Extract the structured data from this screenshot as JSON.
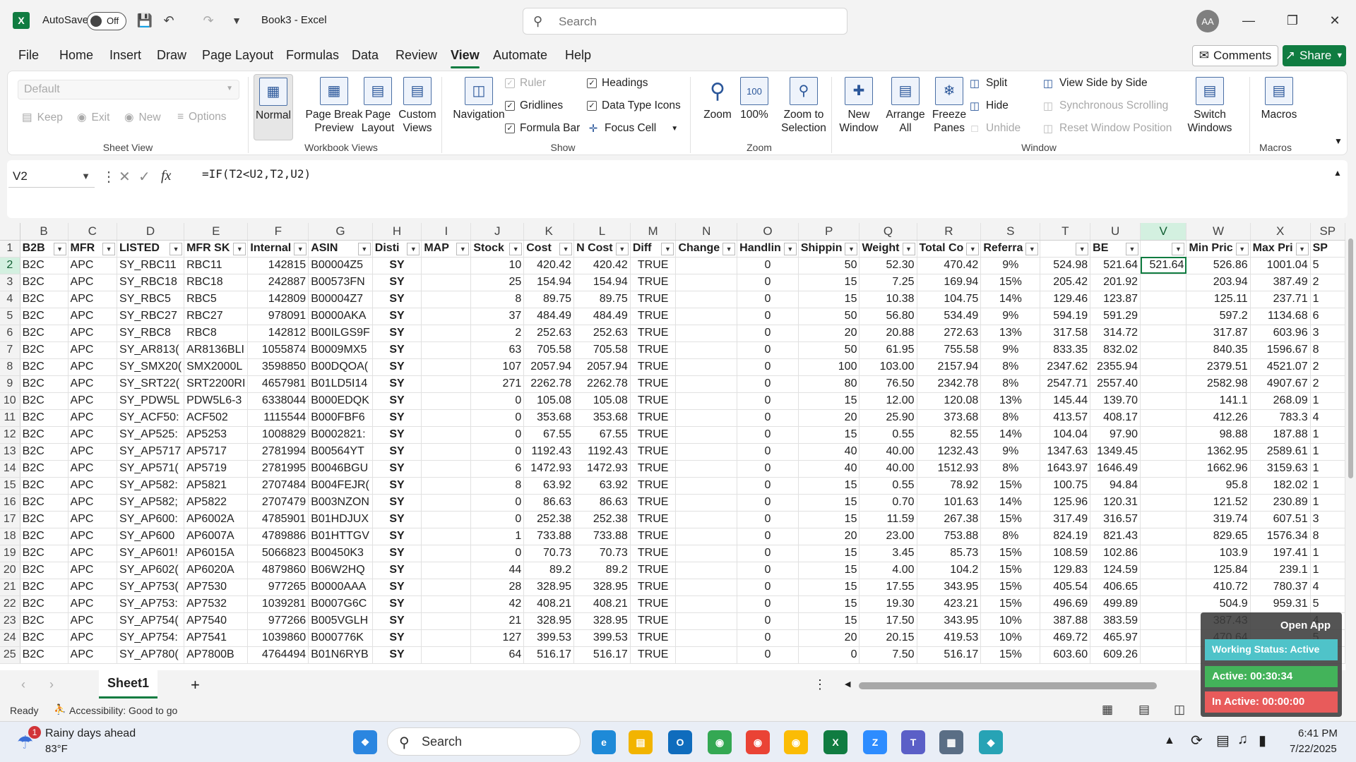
{
  "app": {
    "title": "Book3 - Excel",
    "autosave_label": "AutoSave",
    "autosave_state": "Off",
    "search_placeholder": "Search",
    "user_initials": "AA"
  },
  "menu": [
    "File",
    "Home",
    "Insert",
    "Draw",
    "Page Layout",
    "Formulas",
    "Data",
    "Review",
    "View",
    "Automate",
    "Help"
  ],
  "menu_active": "View",
  "actions": {
    "comments": "Comments",
    "share": "Share"
  },
  "ribbon": {
    "sheet_view": {
      "label": "Sheet View",
      "dropdown": "Default",
      "keep": "Keep",
      "exit": "Exit",
      "new": "New",
      "options": "Options"
    },
    "workbook_views": {
      "label": "Workbook Views",
      "normal": "Normal",
      "page_break_1": "Page Break",
      "page_break_2": "Preview",
      "page_layout_1": "Page",
      "page_layout_2": "Layout",
      "custom_1": "Custom",
      "custom_2": "Views"
    },
    "navigation": "Navigation",
    "show": {
      "label": "Show",
      "ruler": "Ruler",
      "gridlines": "Gridlines",
      "formula_bar": "Formula Bar",
      "headings": "Headings",
      "data_type_icons": "Data Type Icons",
      "focus_cell": "Focus Cell"
    },
    "zoom": {
      "label": "Zoom",
      "zoom": "Zoom",
      "hundred": "100%",
      "zts_1": "Zoom to",
      "zts_2": "Selection"
    },
    "window": {
      "label": "Window",
      "new_1": "New",
      "new_2": "Window",
      "arrange_1": "Arrange",
      "arrange_2": "All",
      "freeze_1": "Freeze",
      "freeze_2": "Panes",
      "split": "Split",
      "hide": "Hide",
      "unhide": "Unhide",
      "side_by_side": "View Side by Side",
      "sync_scroll": "Synchronous Scrolling",
      "reset_pos": "Reset Window Position",
      "switch_1": "Switch",
      "switch_2": "Windows"
    },
    "macros": {
      "label": "Macros",
      "macros": "Macros"
    }
  },
  "formula_bar": {
    "name_box": "V2",
    "formula": "=IF(T2<U2,T2,U2)"
  },
  "grid": {
    "columns": [
      "B",
      "C",
      "D",
      "E",
      "F",
      "G",
      "H",
      "I",
      "J",
      "K",
      "L",
      "M",
      "N",
      "O",
      "P",
      "Q",
      "R",
      "S",
      "T",
      "U",
      "V",
      "W",
      "X",
      "SP"
    ],
    "headers": [
      "B2B",
      "MFR",
      "LISTED",
      "MFR SK",
      "Internal",
      "ASIN",
      "Disti",
      "MAP",
      "Stock",
      "Cost",
      "N Cost",
      "Diff",
      "Change",
      "Handlin",
      "Shippin",
      "Weight",
      "Total Co",
      "Referra",
      "",
      "BE",
      "",
      "Min Pric",
      "Max Pri",
      "SP"
    ],
    "rows": [
      [
        "2",
        "B2C",
        "APC",
        "SY_RBC11",
        "RBC11",
        "142815",
        "B00004Z5",
        "SY",
        "",
        "10",
        "420.42",
        "420.42",
        "TRUE",
        "",
        "0",
        "50",
        "52.30",
        "470.42",
        "9%",
        "524.98",
        "521.64",
        "521.64",
        "526.86",
        "1001.04",
        "5"
      ],
      [
        "3",
        "B2C",
        "APC",
        "SY_RBC18",
        "RBC18",
        "242887",
        "B00573FN",
        "SY",
        "",
        "25",
        "154.94",
        "154.94",
        "TRUE",
        "",
        "0",
        "15",
        "7.25",
        "169.94",
        "15%",
        "205.42",
        "201.92",
        "",
        "203.94",
        "387.49",
        "2"
      ],
      [
        "4",
        "B2C",
        "APC",
        "SY_RBC5",
        "RBC5",
        "142809",
        "B00004Z7",
        "SY",
        "",
        "8",
        "89.75",
        "89.75",
        "TRUE",
        "",
        "0",
        "15",
        "10.38",
        "104.75",
        "14%",
        "129.46",
        "123.87",
        "",
        "125.11",
        "237.71",
        "1"
      ],
      [
        "5",
        "B2C",
        "APC",
        "SY_RBC27",
        "RBC27",
        "978091",
        "B0000AKA",
        "SY",
        "",
        "37",
        "484.49",
        "484.49",
        "TRUE",
        "",
        "0",
        "50",
        "56.80",
        "534.49",
        "9%",
        "594.19",
        "591.29",
        "",
        "597.2",
        "1134.68",
        "6"
      ],
      [
        "6",
        "B2C",
        "APC",
        "SY_RBC8",
        "RBC8",
        "142812",
        "B00ILGS9F",
        "SY",
        "",
        "2",
        "252.63",
        "252.63",
        "TRUE",
        "",
        "0",
        "20",
        "20.88",
        "272.63",
        "13%",
        "317.58",
        "314.72",
        "",
        "317.87",
        "603.96",
        "3"
      ],
      [
        "7",
        "B2C",
        "APC",
        "SY_AR813(",
        "AR8136BLI",
        "1055874",
        "B0009MX5",
        "SY",
        "",
        "63",
        "705.58",
        "705.58",
        "TRUE",
        "",
        "0",
        "50",
        "61.95",
        "755.58",
        "9%",
        "833.35",
        "832.02",
        "",
        "840.35",
        "1596.67",
        "8"
      ],
      [
        "8",
        "B2C",
        "APC",
        "SY_SMX20(",
        "SMX2000L",
        "3598850",
        "B00DQOA(",
        "SY",
        "",
        "107",
        "2057.94",
        "2057.94",
        "TRUE",
        "",
        "0",
        "100",
        "103.00",
        "2157.94",
        "8%",
        "2347.62",
        "2355.94",
        "",
        "2379.51",
        "4521.07",
        "2"
      ],
      [
        "9",
        "B2C",
        "APC",
        "SY_SRT22(",
        "SRT2200RI",
        "4657981",
        "B01LD5I14",
        "SY",
        "",
        "271",
        "2262.78",
        "2262.78",
        "TRUE",
        "",
        "0",
        "80",
        "76.50",
        "2342.78",
        "8%",
        "2547.71",
        "2557.40",
        "",
        "2582.98",
        "4907.67",
        "2"
      ],
      [
        "10",
        "B2C",
        "APC",
        "SY_PDW5L",
        "PDW5L6-3",
        "6338044",
        "B000EDQK",
        "SY",
        "",
        "0",
        "105.08",
        "105.08",
        "TRUE",
        "",
        "0",
        "15",
        "12.00",
        "120.08",
        "13%",
        "145.44",
        "139.70",
        "",
        "141.1",
        "268.09",
        "1"
      ],
      [
        "11",
        "B2C",
        "APC",
        "SY_ACF50:",
        "ACF502",
        "1115544",
        "B000FBF6",
        "SY",
        "",
        "0",
        "353.68",
        "353.68",
        "TRUE",
        "",
        "0",
        "20",
        "25.90",
        "373.68",
        "8%",
        "413.57",
        "408.17",
        "",
        "412.26",
        "783.3",
        "4"
      ],
      [
        "12",
        "B2C",
        "APC",
        "SY_AP525:",
        "AP5253",
        "1008829",
        "B0002821:",
        "SY",
        "",
        "0",
        "67.55",
        "67.55",
        "TRUE",
        "",
        "0",
        "15",
        "0.55",
        "82.55",
        "14%",
        "104.04",
        "97.90",
        "",
        "98.88",
        "187.88",
        "1"
      ],
      [
        "13",
        "B2C",
        "APC",
        "SY_AP5717",
        "AP5717",
        "2781994",
        "B00564YT",
        "SY",
        "",
        "0",
        "1192.43",
        "1192.43",
        "TRUE",
        "",
        "0",
        "40",
        "40.00",
        "1232.43",
        "9%",
        "1347.63",
        "1349.45",
        "",
        "1362.95",
        "2589.61",
        "1"
      ],
      [
        "14",
        "B2C",
        "APC",
        "SY_AP571(",
        "AP5719",
        "2781995",
        "B0046BGU",
        "SY",
        "",
        "6",
        "1472.93",
        "1472.93",
        "TRUE",
        "",
        "0",
        "40",
        "40.00",
        "1512.93",
        "8%",
        "1643.97",
        "1646.49",
        "",
        "1662.96",
        "3159.63",
        "1"
      ],
      [
        "15",
        "B2C",
        "APC",
        "SY_AP582:",
        "AP5821",
        "2707484",
        "B004FEJR(",
        "SY",
        "",
        "8",
        "63.92",
        "63.92",
        "TRUE",
        "",
        "0",
        "15",
        "0.55",
        "78.92",
        "15%",
        "100.75",
        "94.84",
        "",
        "95.8",
        "182.02",
        "1"
      ],
      [
        "16",
        "B2C",
        "APC",
        "SY_AP582;",
        "AP5822",
        "2707479",
        "B003NZON",
        "SY",
        "",
        "0",
        "86.63",
        "86.63",
        "TRUE",
        "",
        "0",
        "15",
        "0.70",
        "101.63",
        "14%",
        "125.96",
        "120.31",
        "",
        "121.52",
        "230.89",
        "1"
      ],
      [
        "17",
        "B2C",
        "APC",
        "SY_AP600:",
        "AP6002A",
        "4785901",
        "B01HDJUX",
        "SY",
        "",
        "0",
        "252.38",
        "252.38",
        "TRUE",
        "",
        "0",
        "15",
        "11.59",
        "267.38",
        "15%",
        "317.49",
        "316.57",
        "",
        "319.74",
        "607.51",
        "3"
      ],
      [
        "18",
        "B2C",
        "APC",
        "SY_AP600",
        "AP6007A",
        "4789886",
        "B01HTTGV",
        "SY",
        "",
        "1",
        "733.88",
        "733.88",
        "TRUE",
        "",
        "0",
        "20",
        "23.00",
        "753.88",
        "8%",
        "824.19",
        "821.43",
        "",
        "829.65",
        "1576.34",
        "8"
      ],
      [
        "19",
        "B2C",
        "APC",
        "SY_AP601!",
        "AP6015A",
        "5066823",
        "B00450K3",
        "SY",
        "",
        "0",
        "70.73",
        "70.73",
        "TRUE",
        "",
        "0",
        "15",
        "3.45",
        "85.73",
        "15%",
        "108.59",
        "102.86",
        "",
        "103.9",
        "197.41",
        "1"
      ],
      [
        "20",
        "B2C",
        "APC",
        "SY_AP602(",
        "AP6020A",
        "4879860",
        "B06W2HQ",
        "SY",
        "",
        "44",
        "89.2",
        "89.2",
        "TRUE",
        "",
        "0",
        "15",
        "4.00",
        "104.2",
        "15%",
        "129.83",
        "124.59",
        "",
        "125.84",
        "239.1",
        "1"
      ],
      [
        "21",
        "B2C",
        "APC",
        "SY_AP753(",
        "AP7530",
        "977265",
        "B0000AAA",
        "SY",
        "",
        "28",
        "328.95",
        "328.95",
        "TRUE",
        "",
        "0",
        "15",
        "17.55",
        "343.95",
        "15%",
        "405.54",
        "406.65",
        "",
        "410.72",
        "780.37",
        "4"
      ],
      [
        "22",
        "B2C",
        "APC",
        "SY_AP753:",
        "AP7532",
        "1039281",
        "B0007G6C",
        "SY",
        "",
        "42",
        "408.21",
        "408.21",
        "TRUE",
        "",
        "0",
        "15",
        "19.30",
        "423.21",
        "15%",
        "496.69",
        "499.89",
        "",
        "504.9",
        "959.31",
        "5"
      ],
      [
        "23",
        "B2C",
        "APC",
        "SY_AP754(",
        "AP7540",
        "977266",
        "B005VGLH",
        "SY",
        "",
        "21",
        "328.95",
        "328.95",
        "TRUE",
        "",
        "0",
        "15",
        "17.50",
        "343.95",
        "10%",
        "387.88",
        "383.59",
        "",
        "387.43",
        "",
        "4"
      ],
      [
        "24",
        "B2C",
        "APC",
        "SY_AP754:",
        "AP7541",
        "1039860",
        "B000776K",
        "SY",
        "",
        "127",
        "399.53",
        "399.53",
        "TRUE",
        "",
        "0",
        "20",
        "20.15",
        "419.53",
        "10%",
        "469.72",
        "465.97",
        "",
        "470.64",
        "",
        "5"
      ],
      [
        "25",
        "B2C",
        "APC",
        "SY_AP780(",
        "AP7800B",
        "4764494",
        "B01N6RYB",
        "SY",
        "",
        "64",
        "516.17",
        "516.17",
        "TRUE",
        "",
        "0",
        "0",
        "7.50",
        "516.17",
        "15%",
        "603.60",
        "609.26",
        "",
        "",
        "",
        "6"
      ]
    ]
  },
  "sheet_tab": "Sheet1",
  "status": {
    "ready": "Ready",
    "accessibility": "Accessibility: Good to go"
  },
  "widget": {
    "open_app": "Open App",
    "working": "Working Status: Active",
    "active": "Active: 00:30:34",
    "inactive": "In Active: 00:00:00"
  },
  "taskbar": {
    "weather_title": "Rainy days ahead",
    "weather_temp": "83°F",
    "weather_badge": "1",
    "search": "Search",
    "time": "6:41 PM",
    "date": "7/22/2025"
  }
}
